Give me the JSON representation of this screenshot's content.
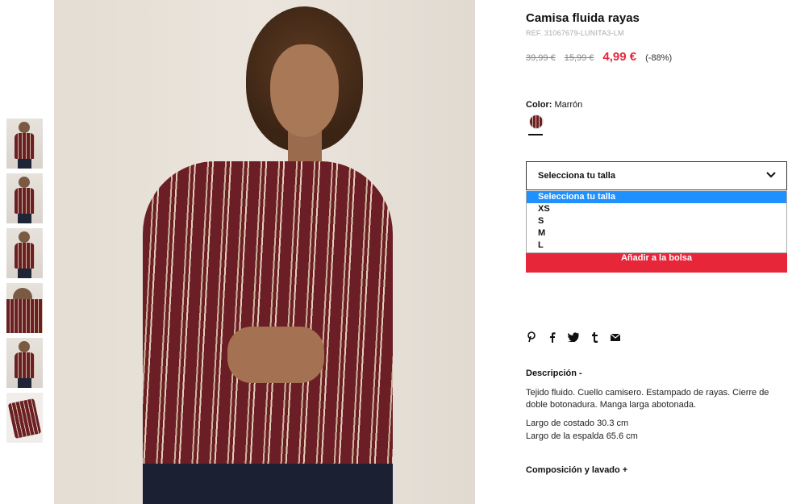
{
  "product": {
    "title": "Camisa fluida rayas",
    "ref": "REF. 31067679-LUNITA3-LM",
    "prices": {
      "original": "39,99 €",
      "previous": "15,99 €",
      "current": "4,99 €",
      "discount": "(-88%)"
    },
    "color": {
      "label": "Color:",
      "value": "Marrón"
    }
  },
  "size_select": {
    "value": "Selecciona tu talla",
    "options": [
      "Selecciona tu talla",
      "XS",
      "S",
      "M",
      "L"
    ]
  },
  "add_to_bag": "Añadir a la bolsa",
  "share": [
    "pinterest-icon",
    "facebook-icon",
    "twitter-icon",
    "tumblr-icon",
    "email-icon"
  ],
  "description": {
    "heading": "Descripción -",
    "text": "Tejido fluido. Cuello camisero. Estampado de rayas. Cierre de doble botonadura. Manga larga abotonada.",
    "measure1": "Largo de costado 30.3 cm",
    "measure2": "Largo de la espalda 65.6 cm"
  },
  "composition_heading": "Composición y lavado +",
  "colors": {
    "accent_red": "#e8263a",
    "selected_option": "#1e90ff"
  }
}
